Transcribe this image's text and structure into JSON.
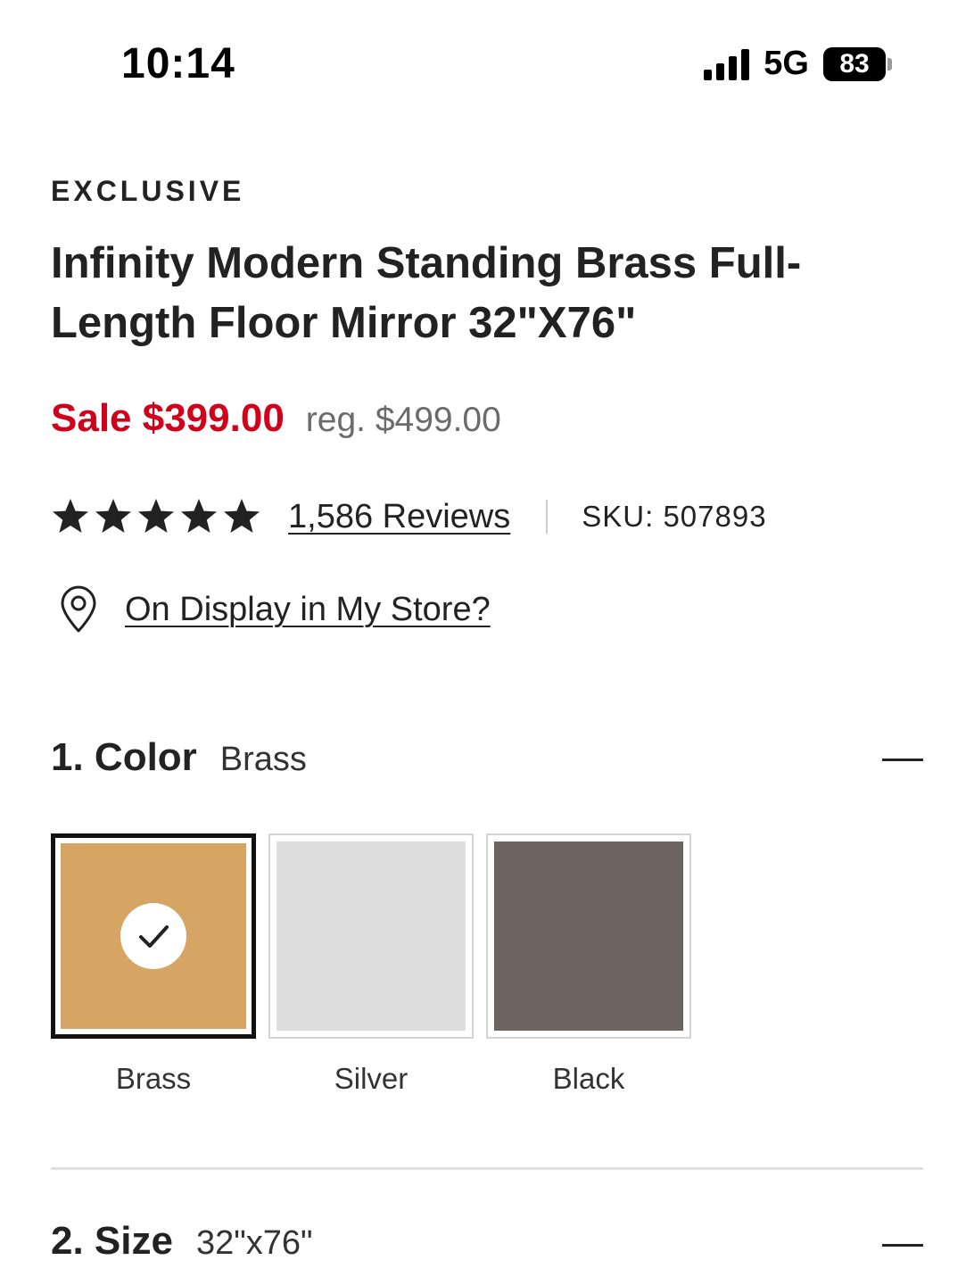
{
  "status_bar": {
    "time": "10:14",
    "network": "5G",
    "battery": "83"
  },
  "product": {
    "badge": "EXCLUSIVE",
    "title": "Infinity Modern Standing Brass Full-Length Floor Mirror 32\"X76\"",
    "sale_price": "Sale $399.00",
    "regular_price": "reg. $499.00",
    "rating": 5,
    "rating_max": 5,
    "reviews_label": "1,586 Reviews",
    "sku": "SKU: 507893",
    "store_link": "On Display in My Store?"
  },
  "color_section": {
    "title": "1. Color",
    "selected_value": "Brass",
    "options": [
      {
        "label": "Brass",
        "color": "#d6a463",
        "selected": true
      },
      {
        "label": "Silver",
        "color": "#dcdcdc",
        "selected": false
      },
      {
        "label": "Black",
        "color": "#6a6560",
        "selected": false
      }
    ]
  },
  "size_section": {
    "title": "2. Size",
    "selected_value": "32\"x76\""
  },
  "colors": {
    "sale": "#d0021b",
    "text": "#222222",
    "muted": "#6b6b6b"
  }
}
